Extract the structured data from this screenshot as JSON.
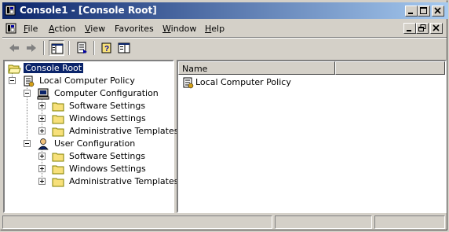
{
  "window": {
    "title": "Console1 - [Console Root]"
  },
  "menubar": {
    "items": [
      {
        "label": "File",
        "key": "F",
        "rest": "ile"
      },
      {
        "label": "Action",
        "key": "A",
        "rest": "ction"
      },
      {
        "label": "View",
        "key": "V",
        "rest": "iew"
      },
      {
        "label": "Favorites",
        "key": "",
        "rest": "Favorites"
      },
      {
        "label": "Window",
        "key": "W",
        "rest": "indow"
      },
      {
        "label": "Help",
        "key": "H",
        "rest": "elp"
      }
    ]
  },
  "tree": {
    "root": "Console Root",
    "policy": "Local Computer Policy",
    "computer": "Computer Configuration",
    "user": "User Configuration",
    "children": {
      "software": "Software Settings",
      "windows": "Windows Settings",
      "admin": "Administrative Templates"
    }
  },
  "list": {
    "columns": [
      "Name"
    ],
    "rows": [
      "Local Computer Policy"
    ]
  },
  "icons": {
    "app": "mmc-console-icon",
    "back": "back-arrow-icon",
    "forward": "forward-arrow-icon"
  },
  "colors": {
    "titlebar_start": "#0a246a",
    "titlebar_end": "#a6caf0",
    "face": "#d4d0c8",
    "selection": "#0a246a",
    "folder": "#f7e07a"
  }
}
